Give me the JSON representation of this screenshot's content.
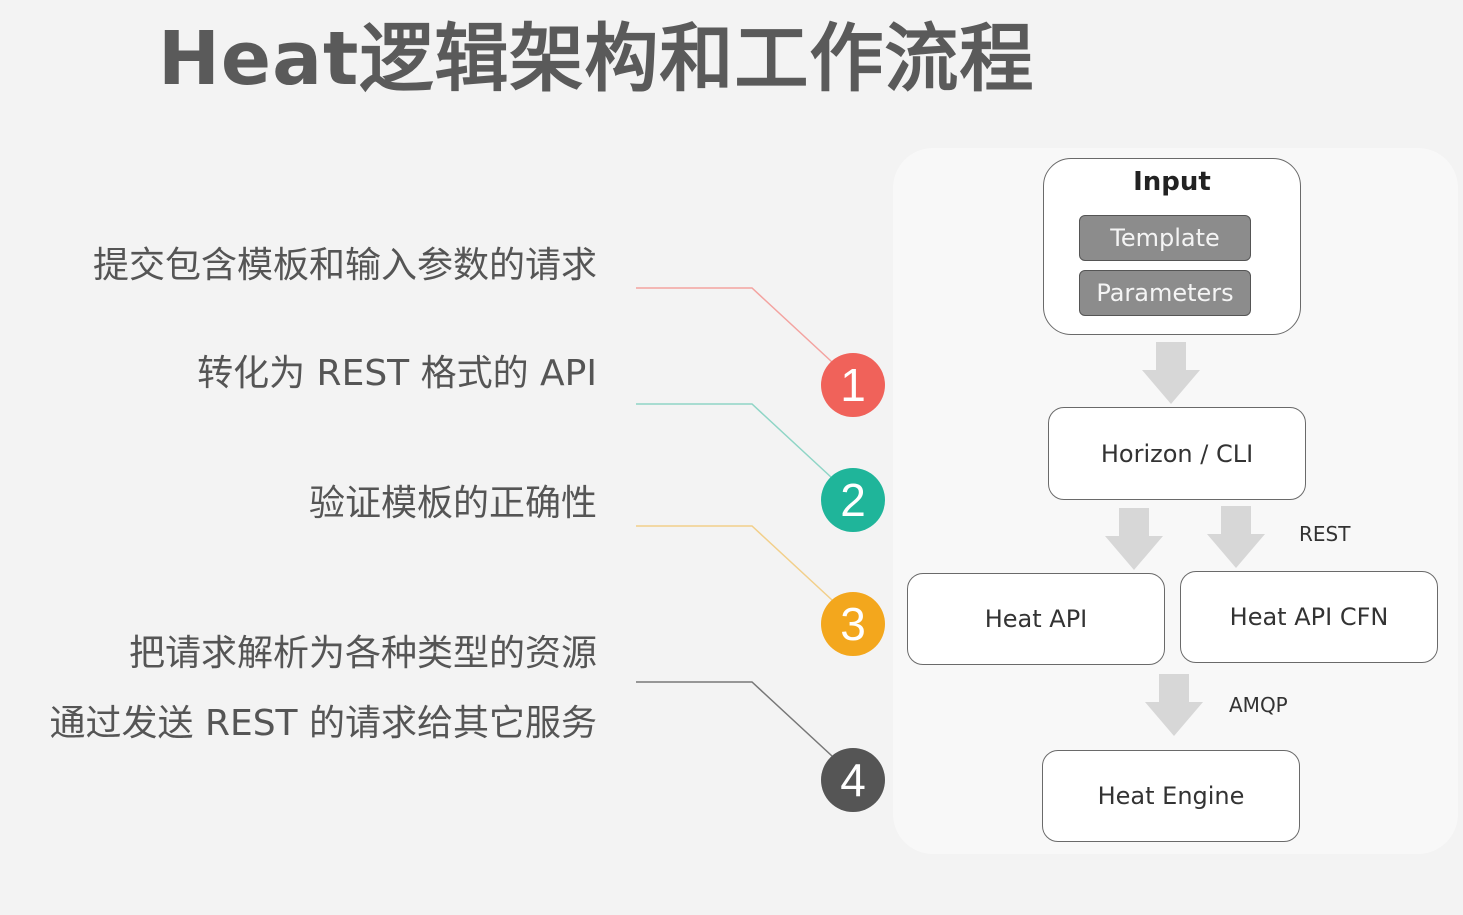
{
  "title": "Heat逻辑架构和工作流程",
  "steps": [
    {
      "number": "1",
      "color": "#f0625a",
      "lines": [
        "提交包含模板和输入参数的请求"
      ]
    },
    {
      "number": "2",
      "color": "#1fb59a",
      "lines": [
        "转化为 REST 格式的 API"
      ]
    },
    {
      "number": "3",
      "color": "#f3a71d",
      "lines": [
        "验证模板的正确性"
      ]
    },
    {
      "number": "4",
      "color": "#555555",
      "lines": [
        "把请求解析为各种类型的资源",
        "通过发送 REST 的请求给其它服务"
      ]
    }
  ],
  "diagram": {
    "input": {
      "title": "Input",
      "items": [
        "Template",
        "Parameters"
      ]
    },
    "horizon": "Horizon / CLI",
    "heat_api": "Heat API",
    "heat_api_cfn": "Heat API CFN",
    "heat_engine": "Heat Engine",
    "label_rest": "REST",
    "label_amqp": "AMQP"
  }
}
